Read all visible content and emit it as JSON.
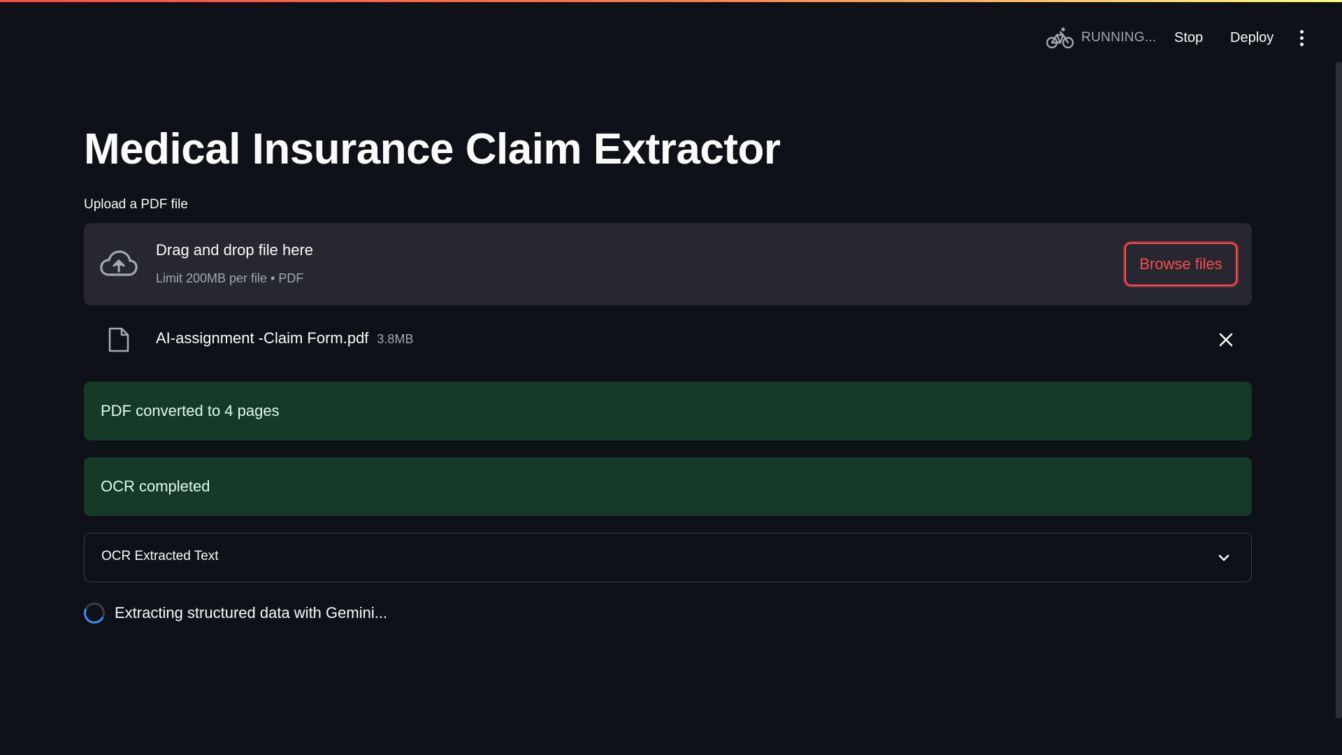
{
  "header": {
    "status_text": "RUNNING...",
    "stop_label": "Stop",
    "deploy_label": "Deploy",
    "status_icon": "bicycle-icon",
    "menu_icon": "kebab-menu-icon"
  },
  "colors": {
    "background": "#0e1117",
    "accent": "#ff4b4b",
    "success_bg": "#173928",
    "success_text": "#dffde9",
    "spinner": "#3e8ef7"
  },
  "main": {
    "title": "Medical Insurance Claim Extractor",
    "uploader": {
      "label": "Upload a PDF file",
      "drop_text": "Drag and drop file here",
      "limit_text": "Limit 200MB per file • PDF",
      "browse_label": "Browse files",
      "icon": "cloud-upload-icon"
    },
    "uploaded_file": {
      "name": "AI-assignment -Claim Form.pdf",
      "size": "3.8MB",
      "icon": "file-icon",
      "remove_icon": "close-icon"
    },
    "alerts": [
      {
        "text": "PDF converted to 4 pages"
      },
      {
        "text": "OCR completed"
      }
    ],
    "expander": {
      "label": "OCR Extracted Text",
      "icon": "chevron-down-icon"
    },
    "spinner": {
      "text": "Extracting structured data with Gemini..."
    }
  }
}
